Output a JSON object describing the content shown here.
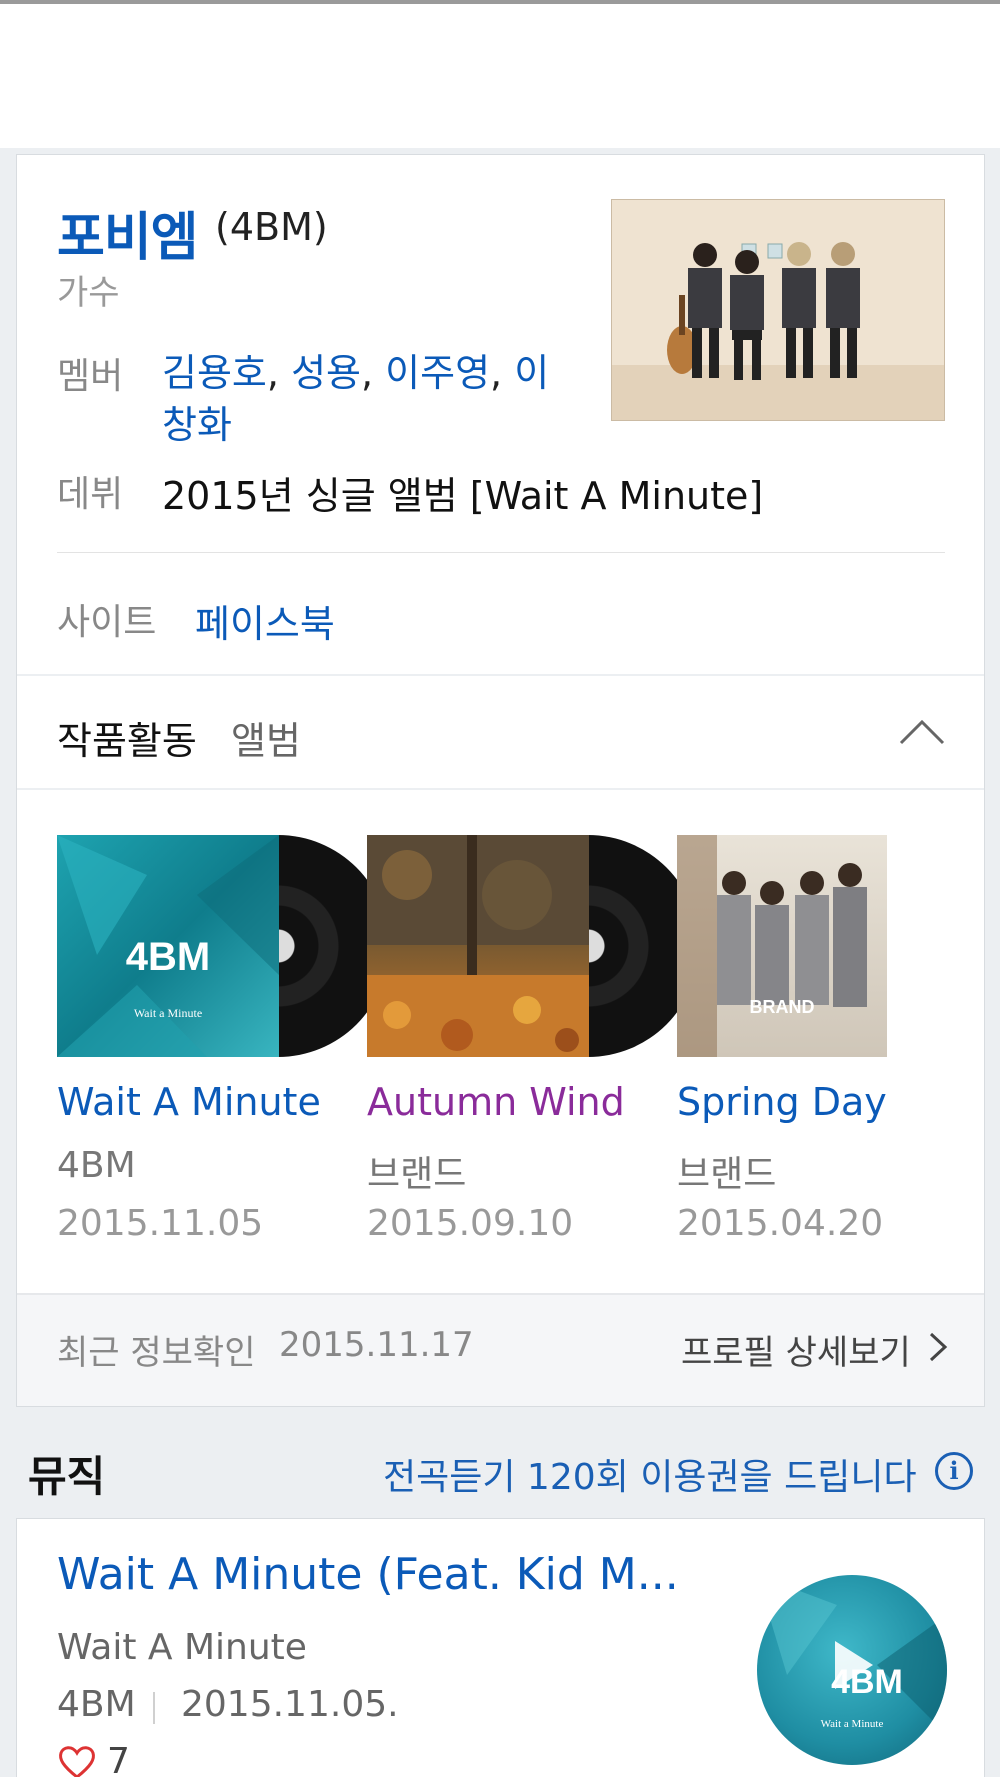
{
  "artist": {
    "name": "포비엠",
    "name_en": "(4BM)",
    "role": "가수",
    "members_label": "멤버",
    "members": [
      "김용호",
      "성용",
      "이주영",
      "이창화"
    ],
    "debut_label": "데뷔",
    "debut_value": "2015년 싱글 앨범 [Wait A Minute]",
    "site_label": "사이트",
    "site_link": "페이스북"
  },
  "works": {
    "title": "작품활동",
    "tab": "앨범",
    "albums": [
      {
        "title": "Wait A Minute",
        "artist": "4BM",
        "date": "2015.11.05",
        "title_color": "#0b5ab8",
        "cover_text": "4BM",
        "cover_sub": "Wait a Minute"
      },
      {
        "title": "Autumn Wind",
        "artist": "브랜드",
        "date": "2015.09.10",
        "title_color": "#8a2b9a"
      },
      {
        "title": "Spring Day",
        "artist": "브랜드",
        "date": "2015.04.20",
        "title_color": "#0b5ab8",
        "cover_text": "BRAND"
      }
    ]
  },
  "footer": {
    "recent_label": "최근 정보확인",
    "recent_date": "2015.11.17",
    "profile_link": "프로필 상세보기"
  },
  "music": {
    "heading": "뮤직",
    "promo": "전곡듣기 120회 이용권을 드립니다",
    "info_glyph": "i",
    "song": {
      "title": "Wait A Minute (Feat. Kid M...",
      "album": "Wait A Minute",
      "artist": "4BM",
      "date": "2015.11.05.",
      "likes": "7",
      "thumb_text": "4BM",
      "thumb_sub": "Wait a Minute"
    }
  },
  "icons": {
    "collapse": "chevron-up-icon",
    "profile_arrow": "chevron-right-icon",
    "info": "info-icon",
    "like": "heart-icon",
    "play": "play-icon"
  }
}
